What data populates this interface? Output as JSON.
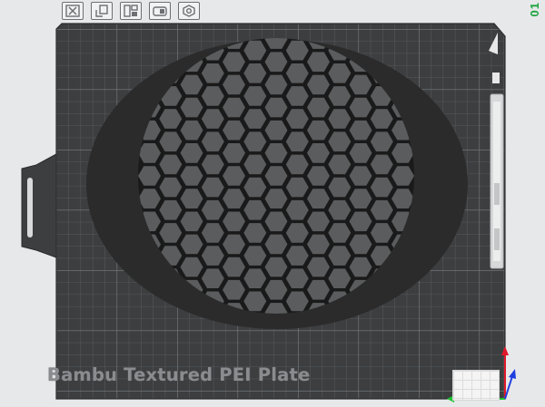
{
  "toolbar": {
    "buttons": [
      {
        "icon": "close-x-icon"
      },
      {
        "icon": "auto-orient-icon"
      },
      {
        "icon": "arrange-icon"
      },
      {
        "icon": "lock-icon"
      },
      {
        "icon": "settings-icon"
      }
    ]
  },
  "plate": {
    "number": "01",
    "label": "Bambu Textured PEI Plate"
  },
  "colors": {
    "plate": "#3c3e40",
    "grid": "#6b6e71",
    "model": "#2b2b2b",
    "accent": "#1aa33b",
    "axis_x": "#e0182a",
    "axis_y": "#1cc42f",
    "axis_z": "#1e3fe0"
  }
}
